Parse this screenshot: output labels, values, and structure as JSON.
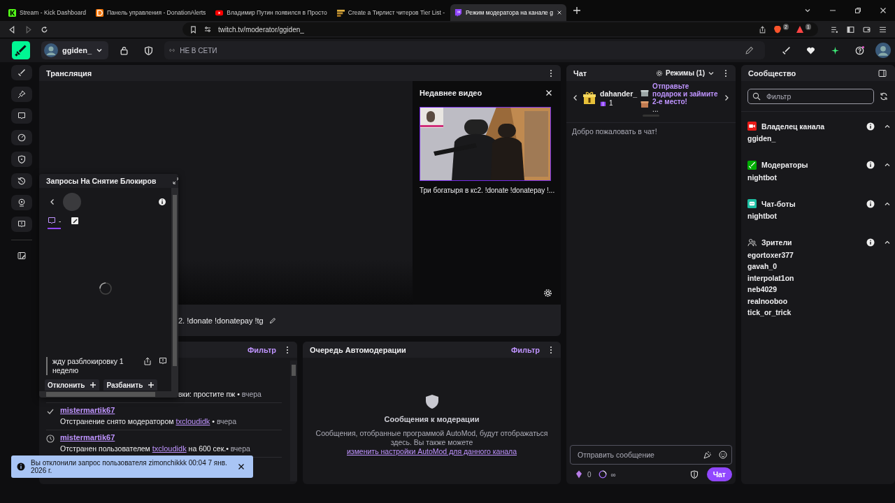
{
  "browser": {
    "tabs": [
      {
        "kind": "kick",
        "title": "Stream - Kick Dashboard",
        "selected": false
      },
      {
        "kind": "donationalerts",
        "title": "Панель управления - DonationAlerts",
        "selected": false
      },
      {
        "kind": "youtube",
        "title": "Владимир Путин появился в Просто",
        "selected": false
      },
      {
        "kind": "tierlist",
        "title": "Create a Тирлист читеров Tier List -",
        "selected": false
      },
      {
        "kind": "twitch",
        "title": "Режим модератора на канале g",
        "selected": true
      }
    ],
    "url": "twitch.tv/moderator/ggiden_",
    "extensions": [
      {
        "kind": "brave",
        "badge": "2"
      },
      {
        "kind": "alert",
        "badge": "1"
      }
    ]
  },
  "topbar": {
    "channel": "ggiden_",
    "status": "НЕ В СЕТИ"
  },
  "stream": {
    "title": "Трансляция",
    "recent_header": "Недавнее видео",
    "video_title": "Три богатыря в кс2. !donate !donatepay !...",
    "stream_title": "2. !donate !donatepay !tg"
  },
  "unban_popup": {
    "title": "Запросы На Снятие Блокиров",
    "tabs": [
      {
        "kind": "chat",
        "label": "-",
        "selected": true
      },
      {
        "kind": "notes",
        "selected": false
      }
    ],
    "message": "жду разблокировку 1 неделю",
    "buttons": [
      "Отклонить",
      "Разбанить"
    ]
  },
  "mod_actions": {
    "filter": "Фильтр",
    "separator": "•",
    "entries": [
      {
        "kind": "fragment",
        "text": "вки: простите пж",
        "time": "вчера"
      },
      {
        "kind": "unban",
        "user": "mistermartik67",
        "text": "Отстранение снято модератором",
        "link": "txcloudidk",
        "time": "вчера"
      },
      {
        "kind": "timeout",
        "user": "mistermartik67",
        "text": "Отстранен пользователем",
        "link": "txcloudidk",
        "after": "на 600 сек.",
        "time": "вчера"
      }
    ]
  },
  "automod": {
    "title": "Очередь Автомодерации",
    "filter": "Фильтр",
    "empty_title": "Сообщения к модерации",
    "empty_text": "Сообщения, отобранные программой AutoMod, будут отображаться здесь. Вы также можете",
    "link": "изменить настройки AutoMod для данного канала"
  },
  "chat": {
    "title": "Чат",
    "modes": "Режимы (1)",
    "leader": {
      "name": "dahander_",
      "count": "1"
    },
    "promo": "Отправьте подарок и займите 2-е место!",
    "promo_more": "...",
    "welcome": "Добро пожаловать в чат!",
    "placeholder": "Отправить сообщение",
    "bits": "0",
    "points": "∞",
    "send": "Чат"
  },
  "community": {
    "title": "Сообщество",
    "placeholder": "Фильтр",
    "groups": [
      {
        "kind": "owner",
        "title": "Владелец канала",
        "expanded": true,
        "users": [
          "ggiden_"
        ]
      },
      {
        "kind": "mods",
        "title": "Модераторы",
        "expanded": true,
        "users": [
          "nightbot"
        ]
      },
      {
        "kind": "bots",
        "title": "Чат-боты",
        "expanded": true,
        "users": [
          "nightbot"
        ]
      },
      {
        "kind": "viewers",
        "title": "Зрители",
        "expanded": true,
        "users": [
          "egortoxer377",
          "gavah_0",
          "interpolat1on",
          "neb4029",
          "realnooboo",
          "tick_or_trick"
        ]
      }
    ]
  },
  "toast": {
    "text": "Вы отклонили запрос пользователя zimonchikkk 00:04 7 янв. 2026 г."
  }
}
